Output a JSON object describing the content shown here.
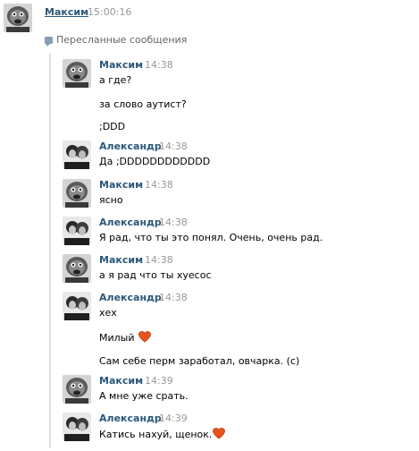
{
  "post": {
    "author": "Максим",
    "time": "15:00:16",
    "forwarded_label": "Пересланные сообщения"
  },
  "messages": [
    {
      "author": "Максим",
      "time": "14:38",
      "avatar": "maxim-avatar",
      "lines": [
        "а где?",
        "за слово аутист?",
        ";DDD"
      ]
    },
    {
      "author": "Александр",
      "time": "14:38",
      "avatar": "alexander-avatar",
      "lines": [
        "Да ;DDDDDDDDDDDD"
      ]
    },
    {
      "author": "Максим",
      "time": "14:38",
      "avatar": "maxim-avatar",
      "lines": [
        "ясно"
      ]
    },
    {
      "author": "Александр",
      "time": "14:38",
      "avatar": "alexander-avatar",
      "lines": [
        "Я рад, что ты это понял. Очень, очень рад."
      ]
    },
    {
      "author": "Максим",
      "time": "14:38",
      "avatar": "maxim-avatar",
      "lines": [
        "а я рад что ты хуесос"
      ]
    },
    {
      "author": "Александр",
      "time": "14:38",
      "avatar": "alexander-avatar",
      "lines": [
        "хех",
        "Милый",
        "Сам себе перм заработал, овчарка. (с)"
      ]
    },
    {
      "author": "Максим",
      "time": "14:39",
      "avatar": "maxim-avatar",
      "lines": [
        "А мне уже срать."
      ]
    },
    {
      "author": "Александр",
      "time": "14:39",
      "avatar": "alexander-avatar",
      "lines": [
        "Катись нахуй, щенок."
      ]
    }
  ],
  "icons": {
    "heart": "heart-emoji-icon",
    "forward": "forwarded-messages-icon"
  },
  "colors": {
    "author_link": "#2b587a",
    "timestamp": "#999999",
    "quote_bar": "#dae1e8",
    "heart": "#e8541c"
  }
}
